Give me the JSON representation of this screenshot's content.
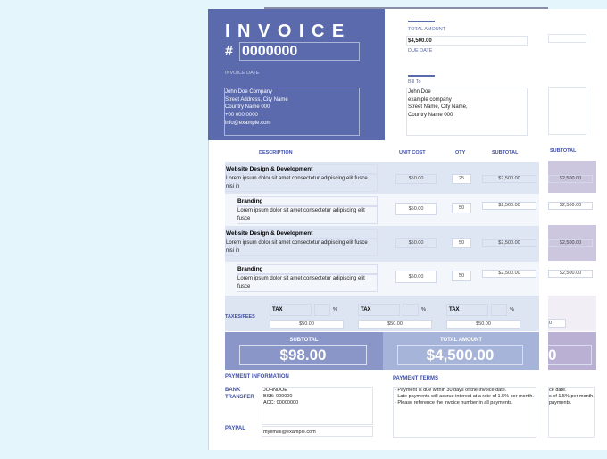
{
  "invoice": {
    "title": "INVOICE",
    "hash": "#",
    "number": "0000000",
    "date_label": "INVOICE DATE",
    "from": [
      "John Doe Company",
      "Street Address, City Name",
      "Country Name 000",
      "+00 000 0000",
      "info@example.com"
    ]
  },
  "summary": {
    "total_label": "TOTAL AMOUNT",
    "total_value": "$4,500.00",
    "due_label": "DUE DATE",
    "bill_to_label": "Bill To",
    "bill_to": [
      "John Doe",
      "example company",
      "Street Name, City Name,",
      "Country Name 000"
    ]
  },
  "table": {
    "headers": [
      "DESCRIPTION",
      "UNIT COST",
      "QTY",
      "SUBTOTAL"
    ],
    "ghost_header": "SUBTOTAL",
    "rows": [
      {
        "title": "Website Design & Development",
        "desc": "Lorem ipsum dolor sit amet consectetur adipiscing elit fusce nisi in",
        "unit": "$50.00",
        "qty": "25",
        "subtotal": "$2,500.00"
      },
      {
        "title": "Branding",
        "desc": "Lorem ipsum dolor sit amet consectetur adipiscing elit fusce",
        "unit": "$50.00",
        "qty": "50",
        "subtotal": "$2,500.00"
      },
      {
        "title": "Website Design & Development",
        "desc": "Lorem ipsum dolor sit amet consectetur adipiscing elit fusce nisi in",
        "unit": "$50.00",
        "qty": "50",
        "subtotal": "$2,500.00"
      },
      {
        "title": "Branding",
        "desc": "Lorem ipsum dolor sit amet consectetur adipiscing elit fusce",
        "unit": "$50.00",
        "qty": "50",
        "subtotal": "$2,500.00"
      }
    ]
  },
  "taxes": {
    "label": "TAXES/FEES",
    "tax_label": "TAX",
    "pct": "%",
    "amount": "$50.00",
    "ghost_amount": "0"
  },
  "totals": {
    "subtotal_label": "SUBTOTAL",
    "subtotal": "$98.00",
    "total_label": "TOTAL AMOUNT",
    "total": "$4,500.00",
    "ghost": "0"
  },
  "payment": {
    "info_label": "PAYMENT INFORMATION",
    "bank_label": "BANK TRANSFER",
    "bank": [
      "JOHNDOE",
      "BSB: 000000",
      "ACC: 00000000"
    ],
    "paypal_label": "PAYPAL",
    "paypal": "myemail@example.com",
    "terms_label": "PAYMENT TERMS",
    "terms": [
      "- Payment is due within 30 days of the invoice date.",
      "- Late payments will accrue interest at a rate of 1.5% per month.",
      "- Please reference the invoice number in all payments."
    ],
    "ghost_terms": [
      "ce date.",
      "s of 1.5% per month.",
      "payments."
    ]
  }
}
